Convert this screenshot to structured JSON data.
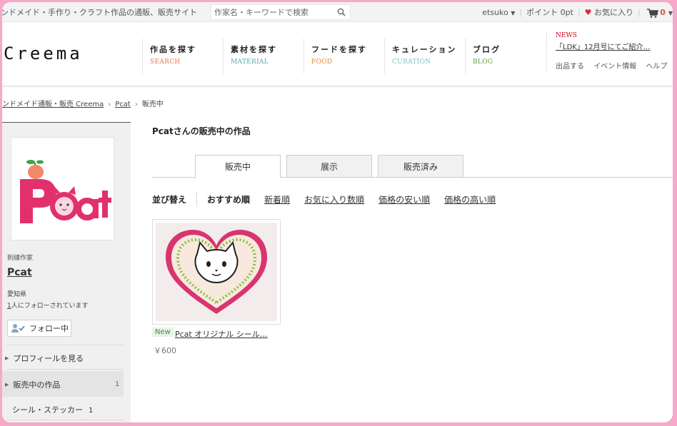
{
  "topbar": {
    "site_description": "ンドメイド・手作り・クラフト作品の通販、販売サイト",
    "search_placeholder": "作家名・キーワードで検索",
    "user": "etsuko",
    "points": "ポイント 0pt",
    "favorites": "お気に入り",
    "cart_count": "0"
  },
  "header": {
    "logo": "Creema",
    "nav": [
      {
        "jp": "作品を探す",
        "en": "SEARCH",
        "color": "#e8735a"
      },
      {
        "jp": "素材を探す",
        "en": "MATERIAL",
        "color": "#5aa8b8"
      },
      {
        "jp": "フードを探す",
        "en": "FOOD",
        "color": "#e08a3c"
      },
      {
        "jp": "キュレーション",
        "en": "CURATION",
        "color": "#7cc0c8"
      },
      {
        "jp": "ブログ",
        "en": "BLOG",
        "color": "#6a9a3a"
      }
    ],
    "news_label": "NEWS",
    "news_text": "「LDK」12月号にてご紹介…",
    "links": {
      "sell": "出品する",
      "events": "イベント情報",
      "help": "ヘルプ"
    }
  },
  "breadcrumb": {
    "home": "ンドメイド通販・販売 Creema",
    "creator": "Pcat",
    "current": "販売中"
  },
  "sidebar": {
    "role": "刺繍作家",
    "name": "Pcat",
    "location": "愛知県",
    "follower_count": "1",
    "follower_suffix": "人にフォローされています",
    "follow_button": "フォロー中",
    "profile_link": "プロフィールを見る",
    "items_link": "販売中の作品",
    "items_count": "1",
    "category": "シール・ステッカー",
    "category_count": "1",
    "avatar_logo": "Pcat"
  },
  "main": {
    "title": "Pcatさんの販売中の作品",
    "tabs": [
      "販売中",
      "展示",
      "販売済み"
    ],
    "sort_label": "並び替え",
    "sort_current": "おすすめ順",
    "sort_options": [
      "新着順",
      "お気に入り数順",
      "価格の安い順",
      "価格の高い順"
    ]
  },
  "items": [
    {
      "badge": "New",
      "title": "Pcat オリジナル シール…",
      "price": "￥600"
    }
  ],
  "colors": {
    "frame": "#f6a9c8",
    "accent_red": "#d0021b",
    "logo_pink": "#e2306c"
  }
}
